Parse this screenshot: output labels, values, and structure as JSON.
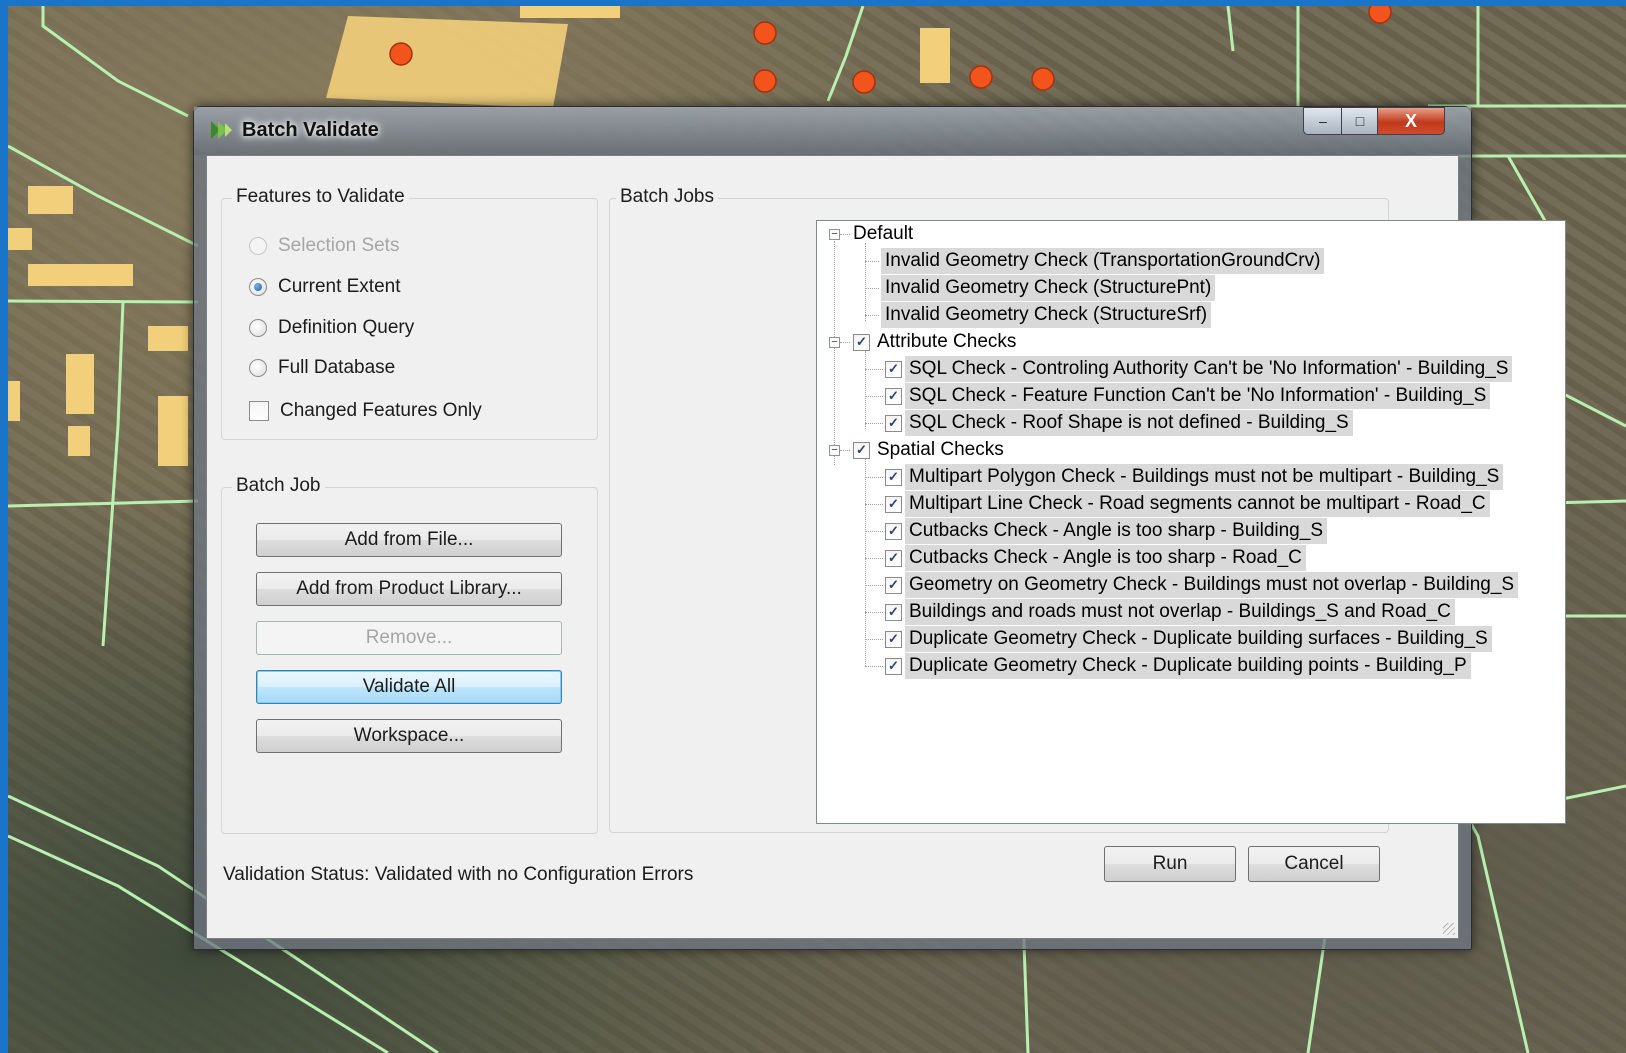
{
  "window": {
    "title": "Batch Validate",
    "controls": {
      "minimize": "‒",
      "maximize": "□",
      "close": "X"
    }
  },
  "features_group": {
    "title": "Features to Validate",
    "options": [
      {
        "label": "Selection Sets",
        "checked": false,
        "enabled": false
      },
      {
        "label": "Current Extent",
        "checked": true,
        "enabled": true
      },
      {
        "label": "Definition Query",
        "checked": false,
        "enabled": true
      },
      {
        "label": "Full Database",
        "checked": false,
        "enabled": true
      }
    ],
    "changed_only": {
      "label": "Changed Features Only",
      "checked": false
    }
  },
  "batch_job_group": {
    "title": "Batch Job",
    "buttons": {
      "add_from_file": "Add from File...",
      "add_from_library": "Add from Product Library...",
      "remove": "Remove...",
      "validate_all": "Validate All",
      "workspace": "Workspace..."
    }
  },
  "batch_jobs": {
    "title": "Batch Jobs",
    "groups": [
      {
        "label": "Default",
        "has_checkbox": false,
        "items": [
          "Invalid Geometry Check (TransportationGroundCrv)",
          "Invalid Geometry Check (StructurePnt)",
          "Invalid Geometry Check (StructureSrf)"
        ]
      },
      {
        "label": "Attribute Checks",
        "has_checkbox": true,
        "items": [
          "SQL Check - Controling Authority Can't be 'No Information' - Building_S",
          "SQL Check - Feature Function Can't be 'No Information' - Building_S",
          "SQL Check - Roof Shape is not defined - Building_S"
        ]
      },
      {
        "label": "Spatial Checks",
        "has_checkbox": true,
        "items": [
          "Multipart Polygon Check - Buildings must not be multipart - Building_S",
          "Multipart Line Check - Road segments cannot be multipart - Road_C",
          "Cutbacks Check - Angle is too sharp - Building_S",
          "Cutbacks Check - Angle is too sharp - Road_C",
          "Geometry on Geometry Check - Buildings must not overlap - Building_S",
          "Buildings and roads must not overlap - Buildings_S and Road_C",
          "Duplicate Geometry Check - Duplicate building surfaces - Building_S",
          "Duplicate Geometry Check - Duplicate building points - Building_P"
        ]
      }
    ]
  },
  "footer": {
    "status": "Validation Status: Validated with no Configuration Errors",
    "run": "Run",
    "cancel": "Cancel"
  },
  "icons": {
    "check": "✓",
    "collapse": "−"
  },
  "colors": {
    "selection_highlight": "#d9d9d9",
    "map_road": "#b9f0b0",
    "map_point": "#f2541b",
    "map_building": "#f2cf7a"
  }
}
